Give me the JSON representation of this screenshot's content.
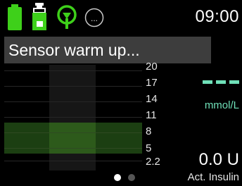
{
  "status": {
    "time": "09:00",
    "icons": [
      "battery-icon",
      "insulin-reservoir-icon",
      "sensor-connection-icon",
      "more-options-icon"
    ],
    "more_label": "..."
  },
  "banner": {
    "message": "Sensor warm up..."
  },
  "graph": {
    "y_ticks": [
      "20",
      "17",
      "14",
      "11",
      "8",
      "5",
      "2.2"
    ]
  },
  "glucose": {
    "value": "- - -",
    "unit": "mmol/L"
  },
  "insulin": {
    "value": "0.0 U",
    "label": "Act. Insulin"
  },
  "pager": {
    "pages": 2,
    "current": 1
  },
  "colors": {
    "battery": "#3ed01a",
    "sensor": "#3ed01a",
    "glucose": "#6fe0b8",
    "banner": "#3d3d3d",
    "target_band": "#1c3f12"
  }
}
